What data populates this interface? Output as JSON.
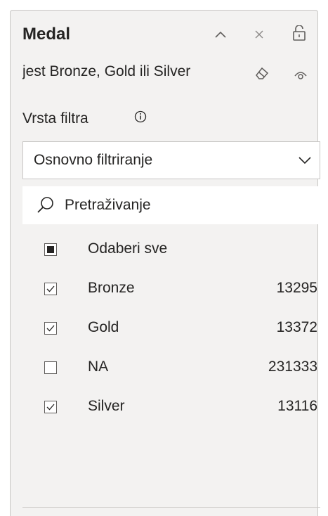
{
  "filter_card": {
    "title": "Medal",
    "subtitle": "jest Bronze, Gold ili Silver",
    "filter_type_label": "Vrsta filtra",
    "filter_type_value": "Osnovno filtriranje",
    "search_placeholder": "Pretraživanje",
    "select_all_label": "Odaberi sve",
    "items": [
      {
        "label": "Bronze",
        "count": "13295",
        "checked": true
      },
      {
        "label": "Gold",
        "count": "13372",
        "checked": true
      },
      {
        "label": "NA",
        "count": "231333",
        "checked": false
      },
      {
        "label": "Silver",
        "count": "13116",
        "checked": true
      }
    ],
    "icons": [
      "collapse-icon",
      "close-icon",
      "unlock-icon",
      "eraser-icon",
      "eye-icon",
      "info-icon",
      "chevron-down-icon",
      "search-icon"
    ]
  }
}
